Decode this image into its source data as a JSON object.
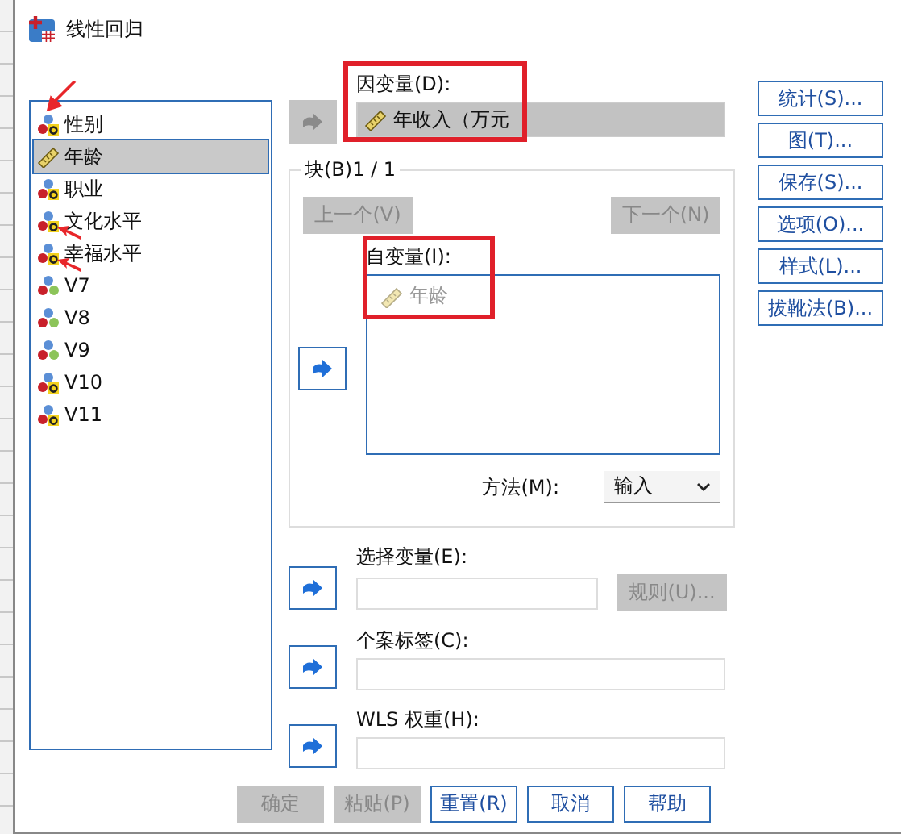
{
  "window": {
    "title": "线性回归"
  },
  "variables": [
    {
      "name": "性别",
      "kind": "string",
      "selected": false,
      "marked": true
    },
    {
      "name": "年龄",
      "kind": "scale",
      "selected": true,
      "marked": false
    },
    {
      "name": "职业",
      "kind": "string",
      "selected": false,
      "marked": false
    },
    {
      "name": "文化水平",
      "kind": "string",
      "selected": false,
      "marked": true
    },
    {
      "name": "幸福水平",
      "kind": "string",
      "selected": false,
      "marked": true
    },
    {
      "name": "V7",
      "kind": "nominal",
      "selected": false,
      "marked": false
    },
    {
      "name": "V8",
      "kind": "nominal",
      "selected": false,
      "marked": false
    },
    {
      "name": "V9",
      "kind": "nominal",
      "selected": false,
      "marked": false
    },
    {
      "name": "V10",
      "kind": "string",
      "selected": false,
      "marked": false
    },
    {
      "name": "V11",
      "kind": "string",
      "selected": false,
      "marked": false
    }
  ],
  "dependent": {
    "label": "因变量(D):",
    "highlighted": true,
    "transfer_disabled": true,
    "value": {
      "name": "年收入（万元",
      "kind": "scale"
    }
  },
  "block": {
    "label": "块(B)1 / 1",
    "prev": {
      "label": "上一个(V)",
      "disabled": true
    },
    "next": {
      "label": "下一个(N)",
      "disabled": true
    }
  },
  "independents": {
    "label": "自变量(I):",
    "highlighted": true,
    "transfer_disabled": false,
    "items": [
      {
        "name": "年龄",
        "kind": "scale",
        "disabled": true
      }
    ]
  },
  "method": {
    "label": "方法(M):",
    "value": "输入"
  },
  "selection": {
    "label": "选择变量(E):",
    "transfer_disabled": false,
    "rule_button": {
      "label": "规则(U)...",
      "disabled": true
    }
  },
  "case_labels": {
    "label": "个案标签(C):",
    "transfer_disabled": false
  },
  "wls": {
    "label": "WLS 权重(H):",
    "transfer_disabled": false
  },
  "side_buttons": [
    {
      "label": "统计(S)..."
    },
    {
      "label": "图(T)..."
    },
    {
      "label": "保存(S)..."
    },
    {
      "label": "选项(O)..."
    },
    {
      "label": "样式(L)..."
    },
    {
      "label": "拔靴法(B)..."
    }
  ],
  "footer_buttons": [
    {
      "label": "确定",
      "disabled": true
    },
    {
      "label": "粘贴(P)",
      "disabled": true
    },
    {
      "label": "重置(R)",
      "disabled": false
    },
    {
      "label": "取消",
      "disabled": false
    },
    {
      "label": "帮助",
      "disabled": false
    }
  ]
}
